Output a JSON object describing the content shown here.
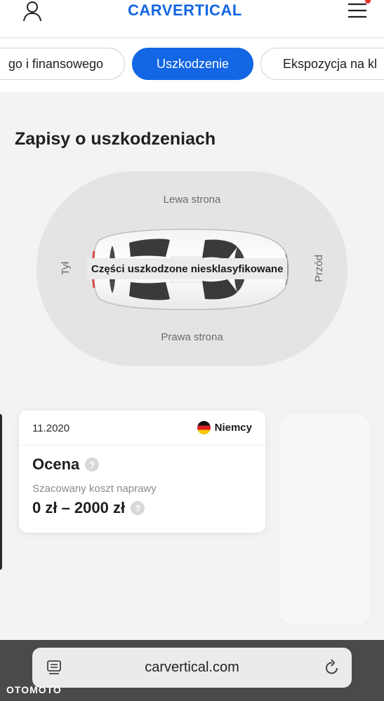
{
  "header": {
    "logo_text": "CARVERTICAL",
    "user_icon": "user-icon",
    "menu_icon": "hamburger-menu-icon",
    "brand_color": "#1366e4",
    "notification_color": "#e5322d"
  },
  "tabs": [
    {
      "label": "go i finansowego",
      "active": false
    },
    {
      "label": "Uszkodzenie",
      "active": true
    },
    {
      "label": "Ekspozycja na kl",
      "active": false
    }
  ],
  "tabs_progress": 0.44,
  "section": {
    "title": "Zapisy o uszkodzeniach",
    "diagram": {
      "left_side": "Lewa strona",
      "right_side": "Prawa strona",
      "rear": "Tył",
      "front": "Przód",
      "overlay": "Części uszkodzone niesklasyfikowane"
    }
  },
  "record": {
    "date": "11.2020",
    "country": "Niemcy",
    "flag_icon": "germany-flag-icon",
    "grade_label": "Ocena",
    "cost_label": "Szacowany koszt naprawy",
    "cost_value": "0 zł – 2000 zł",
    "help_glyph": "?"
  },
  "browser": {
    "url": "carvertical.com",
    "tabs_icon": "tabs-icon",
    "reload_icon": "reload-icon"
  },
  "watermark": "OTOMOTO"
}
